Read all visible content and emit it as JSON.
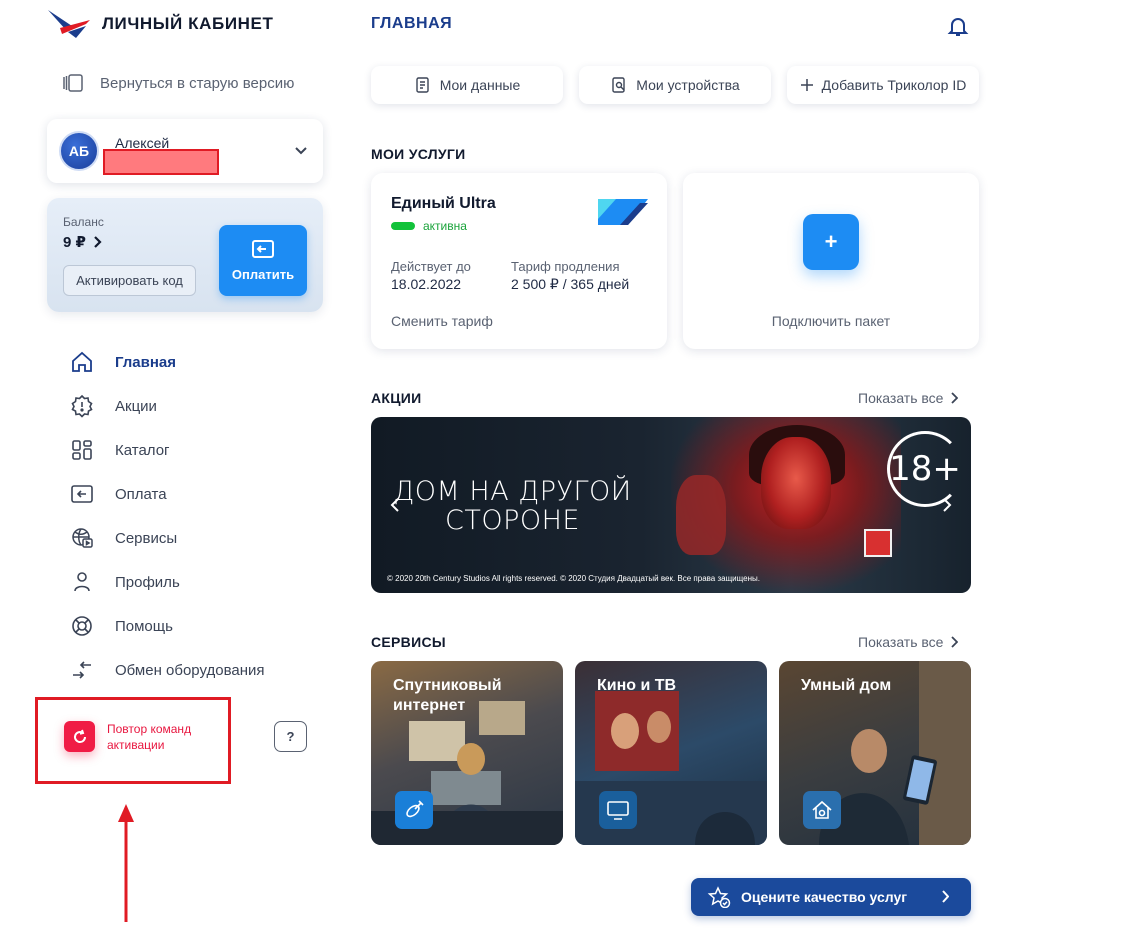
{
  "brand": {
    "logo_text": "ЛИЧНЫЙ КАБИНЕТ"
  },
  "sidebar": {
    "old_version_label": "Вернуться в старую версию",
    "user": {
      "initials": "АБ",
      "name": "Алексей"
    },
    "balance": {
      "label": "Баланс",
      "value": "9 ₽",
      "activate_label": "Активировать код",
      "pay_label": "Оплатить"
    },
    "nav": [
      {
        "label": "Главная",
        "icon": "home-icon",
        "active": true
      },
      {
        "label": "Акции",
        "icon": "badge-icon",
        "active": false
      },
      {
        "label": "Каталог",
        "icon": "catalog-icon",
        "active": false
      },
      {
        "label": "Оплата",
        "icon": "payment-icon",
        "active": false
      },
      {
        "label": "Сервисы",
        "icon": "services-icon",
        "active": false
      },
      {
        "label": "Профиль",
        "icon": "profile-icon",
        "active": false
      },
      {
        "label": "Помощь",
        "icon": "lifebuoy-icon",
        "active": false
      },
      {
        "label": "Обмен оборудования",
        "icon": "exchange-icon",
        "active": false
      }
    ],
    "repeat_activation": "Повтор команд активации",
    "help_label": "?"
  },
  "header": {
    "title": "ГЛАВНАЯ",
    "buttons": {
      "my_data": "Мои данные",
      "my_devices": "Мои устройства",
      "add_id": "Добавить Триколор ID"
    }
  },
  "services": {
    "title": "МОИ УСЛУГИ",
    "card": {
      "name": "Единый Ultra",
      "status": "активна",
      "valid_label": "Действует до",
      "valid_value": "18.02.2022",
      "tariff_label": "Тариф продления",
      "tariff_value": "2 500 ₽ / 365 дней",
      "change_label": "Сменить тариф"
    },
    "add": {
      "plus": "+",
      "label": "Подключить пакет"
    }
  },
  "promos": {
    "title": "АКЦИИ",
    "show_all": "Показать все",
    "banner": {
      "line1": "ДОМ НА ДРУГОЙ",
      "line2": "СТОРОНЕ",
      "age": "18+",
      "copyright": "© 2020 20th Century Studios All rights reserved. © 2020 Студия Двадцатый век. Все права защищены."
    }
  },
  "service_tiles": {
    "title": "СЕРВИСЫ",
    "show_all": "Показать все",
    "items": [
      {
        "title": "Спутниковый интернет",
        "icon": "satellite-icon"
      },
      {
        "title": "Кино и ТВ",
        "icon": "tv-icon"
      },
      {
        "title": "Умный дом",
        "icon": "smart-home-icon"
      }
    ]
  },
  "rate_button": "Оцените качество услуг",
  "colors": {
    "primary": "#1d8cf3",
    "brand_dark": "#1b3d8c",
    "alert": "#e01b24",
    "active_green": "#12c23a"
  }
}
